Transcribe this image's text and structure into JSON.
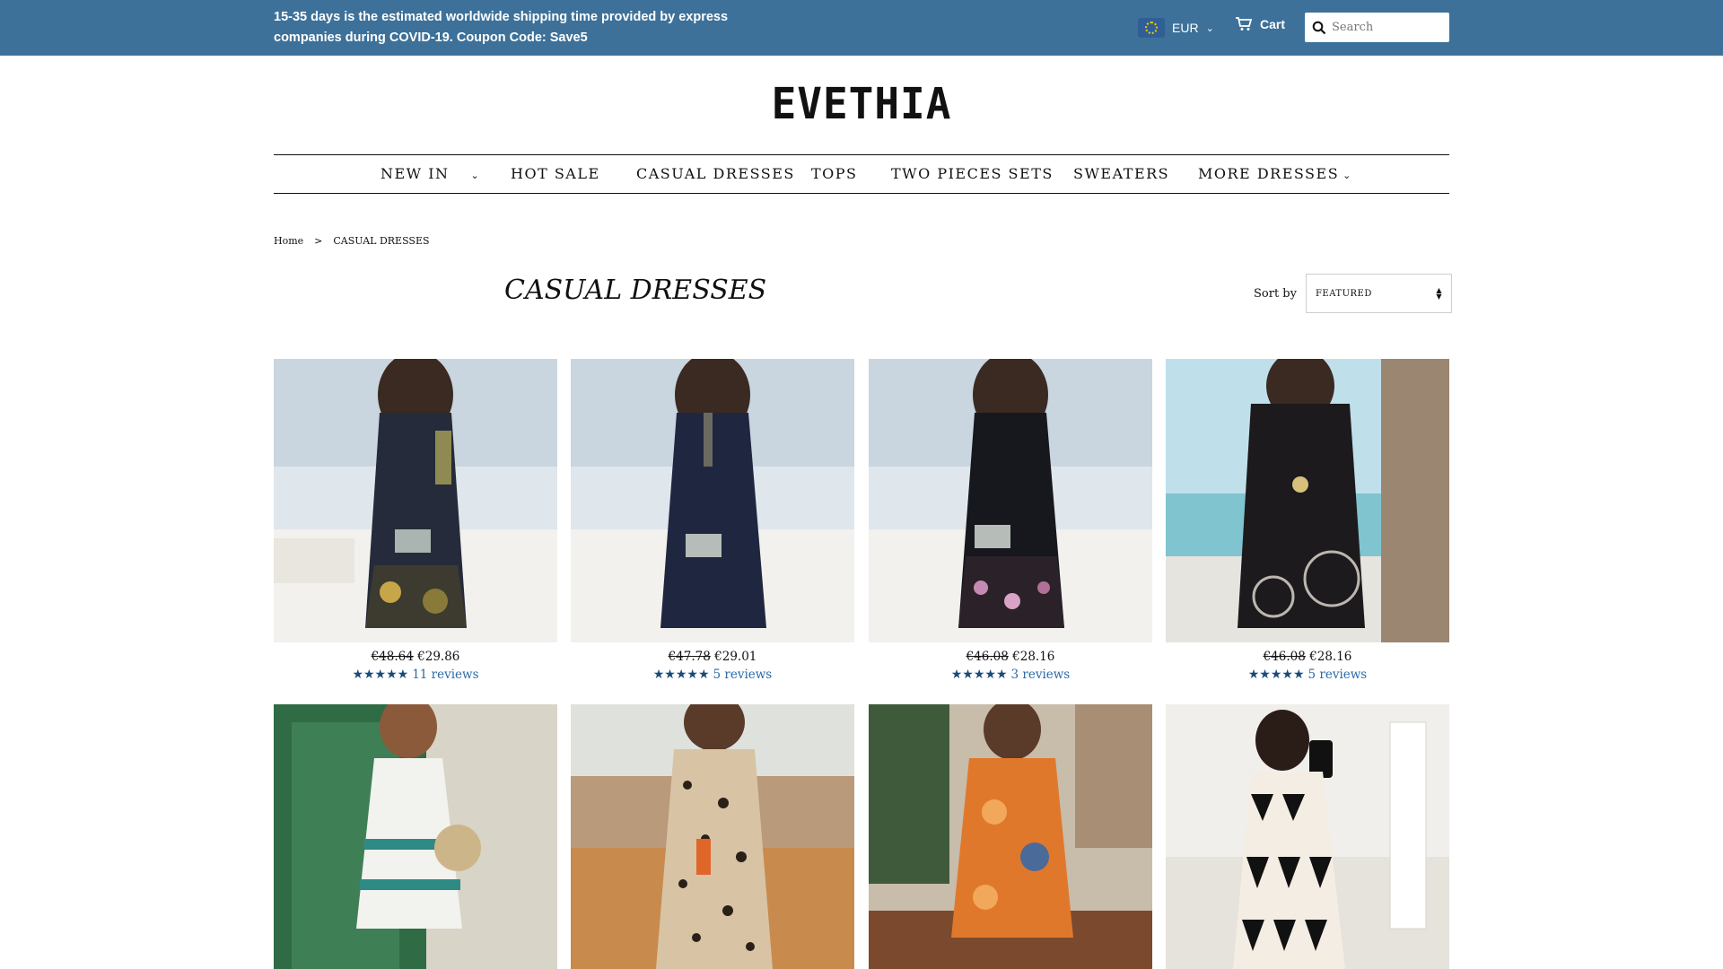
{
  "announcement": "15-35 days is the estimated worldwide shipping time provided by express companies during COVID-19. Coupon Code: Save5",
  "currency": {
    "label": "EUR",
    "flag_icon": "eu-flag-icon"
  },
  "cart": {
    "label": "Cart"
  },
  "search": {
    "placeholder": "Search"
  },
  "logo": "EVETHIA",
  "nav": {
    "items": [
      {
        "label": "NEW IN",
        "has_dropdown": true
      },
      {
        "label": "HOT SALE",
        "has_dropdown": false
      },
      {
        "label": "CASUAL DRESSES",
        "has_dropdown": false
      },
      {
        "label": "TOPS",
        "has_dropdown": false
      },
      {
        "label": "TWO PIECES SETS",
        "has_dropdown": false
      },
      {
        "label": "SWEATERS",
        "has_dropdown": false
      },
      {
        "label": "MORE DRESSES",
        "has_dropdown": true
      }
    ]
  },
  "breadcrumb": {
    "home": "Home",
    "separator": ">",
    "current": "CASUAL DRESSES"
  },
  "page_title": "CASUAL DRESSES",
  "sort": {
    "label": "Sort by",
    "selected": "FEATURED"
  },
  "products": [
    {
      "old_price": "€48.64",
      "price": "€29.86",
      "stars": "★★★★★",
      "reviews": "11 reviews"
    },
    {
      "old_price": "€47.78",
      "price": "€29.01",
      "stars": "★★★★★",
      "reviews": "5 reviews"
    },
    {
      "old_price": "€46.08",
      "price": "€28.16",
      "stars": "★★★★★",
      "reviews": "3 reviews"
    },
    {
      "old_price": "€46.08",
      "price": "€28.16",
      "stars": "★★★★★",
      "reviews": "5 reviews"
    },
    {},
    {},
    {},
    {}
  ],
  "colors": {
    "topbar": "#3d7199",
    "star": "#1b4a7a",
    "link": "#2b6aa6"
  }
}
